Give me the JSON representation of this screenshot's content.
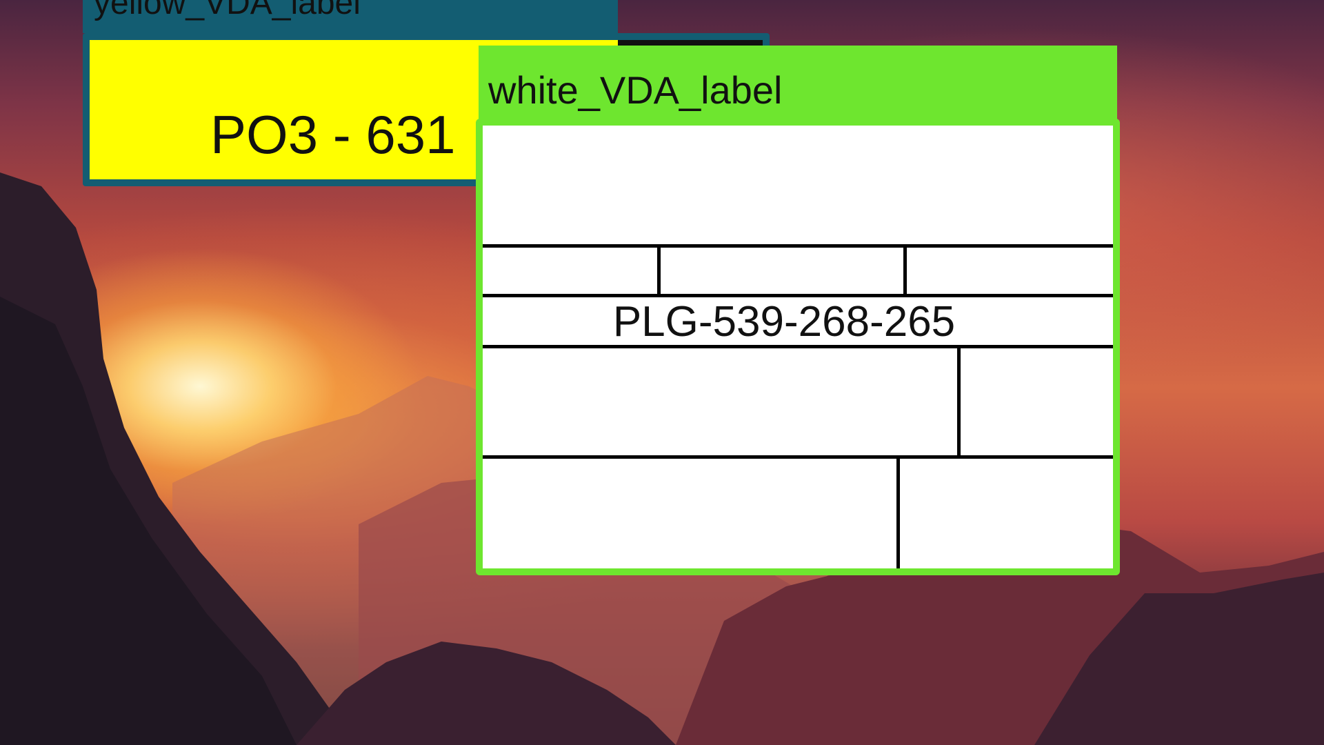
{
  "desktop": {
    "wallpaper": "mountain-valley-sunset"
  },
  "yellow_window": {
    "title": "yellow_VDA_label",
    "po_text": "PO3 - 631",
    "colors": {
      "titlebar": "#135d72",
      "panel": "#ffff00"
    }
  },
  "white_window": {
    "title": "white_VDA_label",
    "plg_text": "PLG-539-268-265",
    "colors": {
      "titlebar": "#6ee62f",
      "panel": "#ffffff"
    }
  }
}
